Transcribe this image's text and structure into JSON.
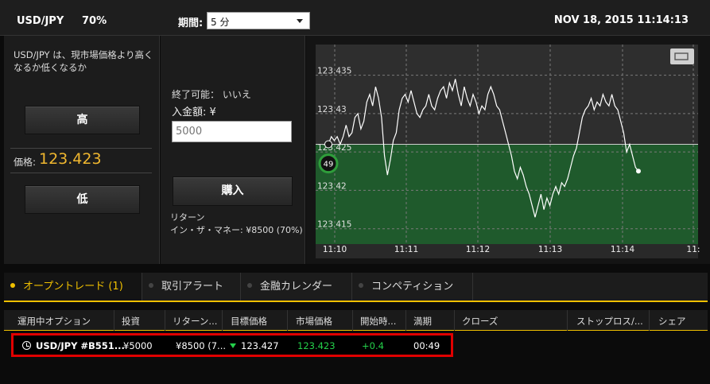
{
  "header": {
    "pair": "USD/JPY",
    "percent": "70%",
    "period_label": "期間:",
    "period_value": "5 分",
    "datetime": "NOV 18, 2015 11:14:13"
  },
  "left": {
    "description": "USD/JPY は、現市場価格より高くなるか低くなるか",
    "high_label": "高",
    "price_label": "価格:",
    "price_value": "123.423",
    "low_label": "低"
  },
  "middle": {
    "close_possible": "終了可能： いいえ",
    "deposit_label": "入金額: ¥",
    "amount_value": "5000",
    "buy_label": "購入",
    "return_label": "リターン",
    "itm_label": "イン・ザ・マネー: ¥8500 (70%)"
  },
  "chart_data": {
    "type": "line",
    "y_ticks": [
      "123.435",
      "123.43",
      "123.425",
      "123.42",
      "123.415"
    ],
    "x_ticks": [
      "11:10",
      "11:11",
      "11:12",
      "11:13",
      "11:14",
      "11:"
    ],
    "ylim": [
      123.413,
      123.439
    ],
    "strike": 123.426,
    "badge": "49",
    "colors": {
      "win_zone": "#1f5a2c",
      "line": "#ffffff",
      "grid": "#7a7a7a",
      "badge_ring": "#2f9d3b"
    },
    "series": [
      {
        "values": [
          123.426,
          123.427,
          123.4265,
          123.427,
          123.426,
          123.427,
          123.4285,
          123.427,
          123.4275,
          123.4295,
          123.43,
          123.428,
          123.429,
          123.4315,
          123.4325,
          123.431,
          123.4335,
          123.432,
          123.4295,
          123.4245,
          123.422,
          123.424,
          123.4265,
          123.4275,
          123.4305,
          123.432,
          123.4325,
          123.4315,
          123.433,
          123.4315,
          123.43,
          123.4295,
          123.4305,
          123.431,
          123.4325,
          123.431,
          123.4305,
          123.432,
          123.433,
          123.4335,
          123.432,
          123.434,
          123.433,
          123.4345,
          123.4325,
          123.431,
          123.4335,
          123.432,
          123.431,
          123.4325,
          123.4315,
          123.43,
          123.431,
          123.4305,
          123.4325,
          123.4335,
          123.4325,
          123.431,
          123.4305,
          123.429,
          123.4275,
          123.426,
          123.4245,
          123.4225,
          123.4215,
          123.423,
          123.422,
          123.4205,
          123.4195,
          123.418,
          123.4165,
          123.418,
          123.4195,
          123.4175,
          123.419,
          123.418,
          123.4195,
          123.4205,
          123.4195,
          123.421,
          123.4205,
          123.4215,
          123.423,
          123.4245,
          123.4255,
          123.4275,
          123.4295,
          123.4305,
          123.431,
          123.432,
          123.4305,
          123.4315,
          123.431,
          123.4325,
          123.4315,
          123.431,
          123.4325,
          123.431,
          123.4305,
          123.429,
          123.4275,
          123.425,
          123.426,
          123.4245,
          123.423,
          123.4225
        ]
      }
    ]
  },
  "tabs": [
    {
      "label": "オープントレード (1)",
      "active": true
    },
    {
      "label": "取引アラート",
      "active": false
    },
    {
      "label": "金融カレンダー",
      "active": false
    },
    {
      "label": "コンペティション",
      "active": false
    }
  ],
  "table": {
    "headers": [
      "運用中オプション",
      "投資",
      "リターン...",
      "目標価格",
      "市場価格",
      "開始時...",
      "満期",
      "クローズ",
      "ストップロス/...",
      "シェア"
    ],
    "row": {
      "option": "USD/JPY #B551...",
      "invest": "¥5000",
      "return": "¥8500 (7...",
      "target": "123.427",
      "market": "123.423",
      "change": "+0.4",
      "expiry": "00:49"
    }
  }
}
